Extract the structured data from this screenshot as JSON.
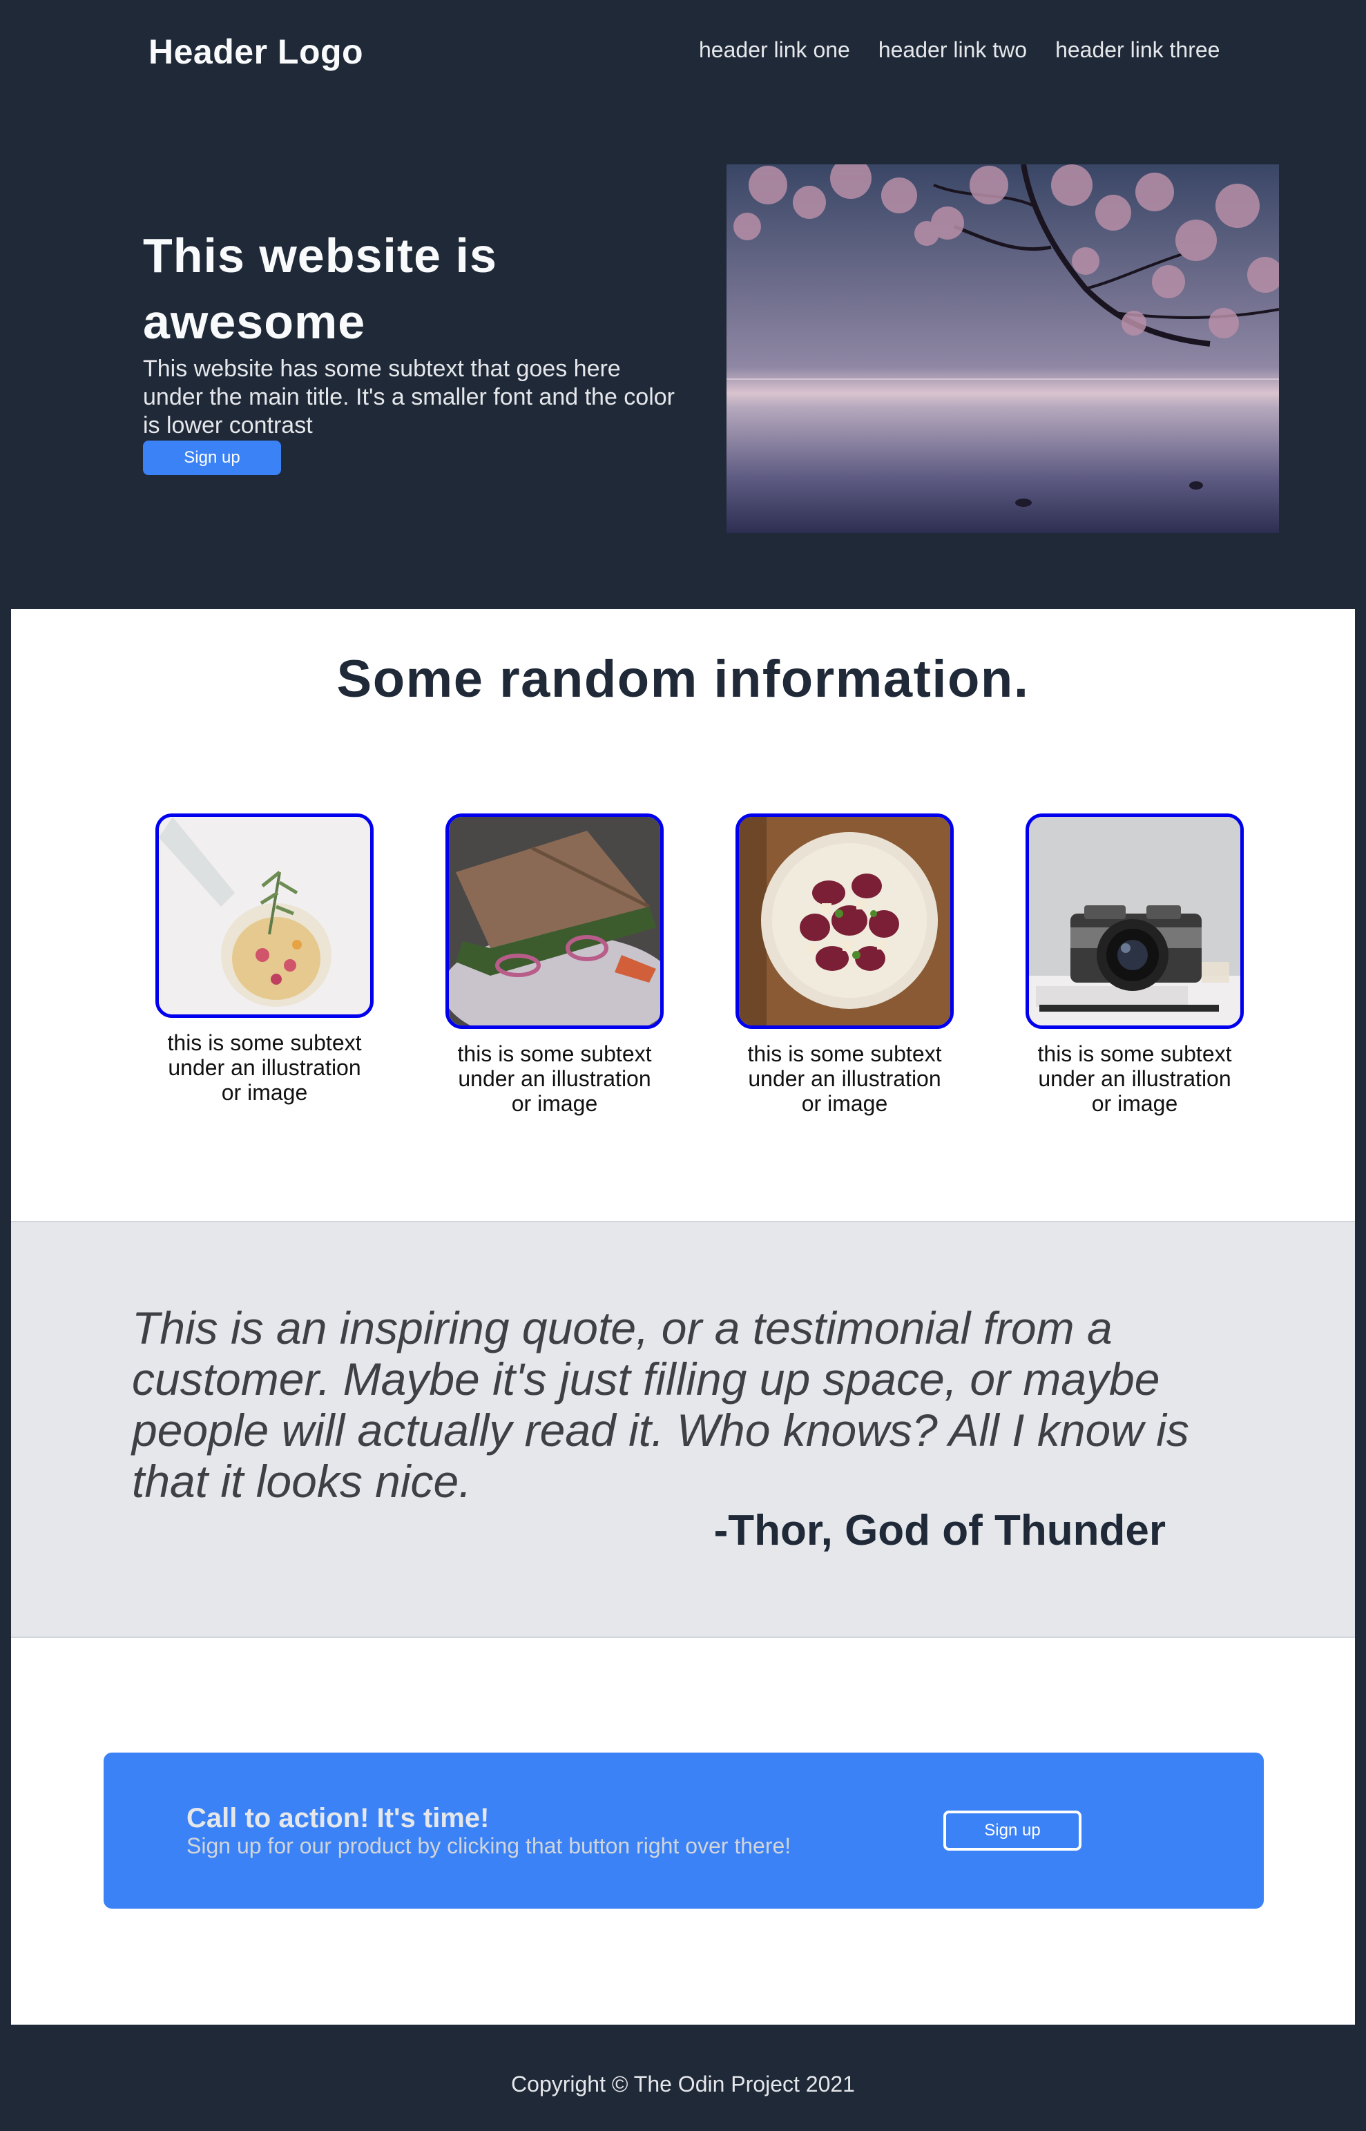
{
  "header": {
    "logo": "Header Logo",
    "links": [
      "header link one",
      "header link two",
      "header link three"
    ]
  },
  "hero": {
    "title": "This website is awesome",
    "subtext": "This website has some subtext that goes here under the main title. It's a smaller font and the color is lower contrast",
    "button_label": "Sign up",
    "image_icon": "cherry-blossom-lake-image"
  },
  "info": {
    "title": "Some random information.",
    "cards": [
      {
        "caption": "this is some subtext under an illustration or image",
        "icon": "drink-glass-image"
      },
      {
        "caption": "this is some subtext under an illustration or image",
        "icon": "sandwich-image"
      },
      {
        "caption": "this is some subtext under an illustration or image",
        "icon": "plated-dish-image"
      },
      {
        "caption": "this is some subtext under an illustration or image",
        "icon": "camera-image"
      }
    ]
  },
  "quote": {
    "text": "This is an inspiring quote, or a testimonial from a customer. Maybe it's just filling up space, or maybe people will actually read it. Who knows? All I know is that it looks nice.",
    "author": "-Thor, God of Thunder"
  },
  "cta": {
    "title": "Call to action! It's time!",
    "subtext": "Sign up for our product by clicking that button right over there!",
    "button_label": "Sign up"
  },
  "footer": {
    "copyright": "Copyright © The Odin Project 2021"
  },
  "colors": {
    "dark": "#1f2937",
    "accent": "#3b82f6",
    "card_border": "#0000ee",
    "quote_bg": "#e5e7eb"
  }
}
